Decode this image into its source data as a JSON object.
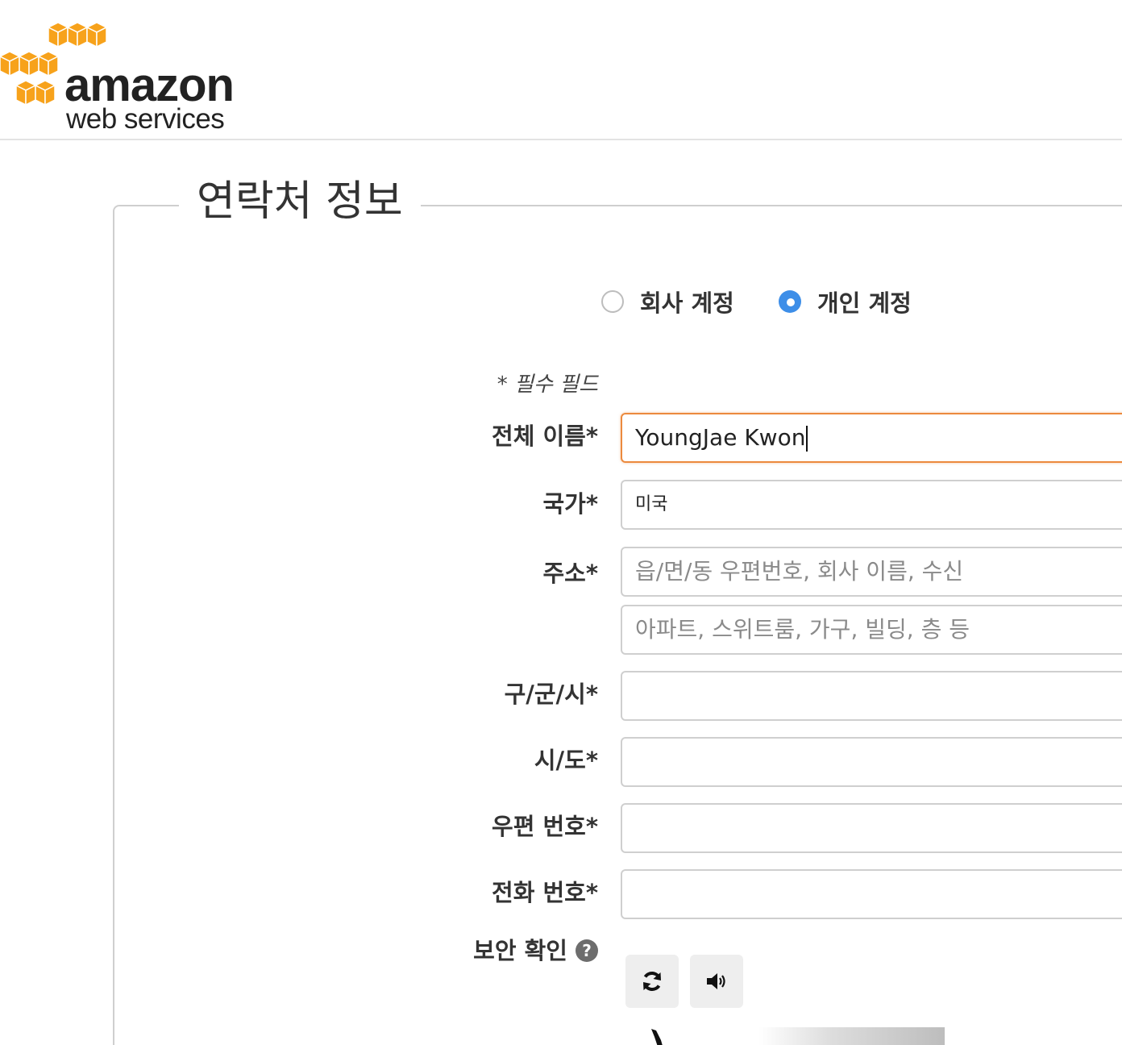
{
  "header": {
    "logo_line1": "amazon",
    "logo_line2": "web services",
    "logo_color": "#f7a21b"
  },
  "form": {
    "legend": "연락처 정보",
    "account_types": [
      {
        "label": "회사 계정",
        "checked": false
      },
      {
        "label": "개인 계정",
        "checked": true
      }
    ],
    "required_note": "* 필수 필드",
    "fields": {
      "full_name": {
        "label": "전체 이름*",
        "value": "YoungJae Kwon"
      },
      "country": {
        "label": "국가*",
        "value": "미국"
      },
      "address": {
        "label": "주소*",
        "line1_placeholder": "읍/면/동 우편번호, 회사 이름, 수신",
        "line2_placeholder": "아파트, 스위트룸, 가구, 빌딩, 층 등"
      },
      "district": {
        "label": "구/군/시*",
        "value": ""
      },
      "state": {
        "label": "시/도*",
        "value": ""
      },
      "postal": {
        "label": "우편 번호*",
        "value": ""
      },
      "phone": {
        "label": "전화 번호*",
        "value": ""
      }
    },
    "security": {
      "label": "보안 확인",
      "help_glyph": "?",
      "refresh_icon": "refresh-icon",
      "audio_icon": "speaker-icon"
    }
  },
  "colors": {
    "radio_checked": "#3d8ee8",
    "focus_border": "#ec8a3e"
  }
}
